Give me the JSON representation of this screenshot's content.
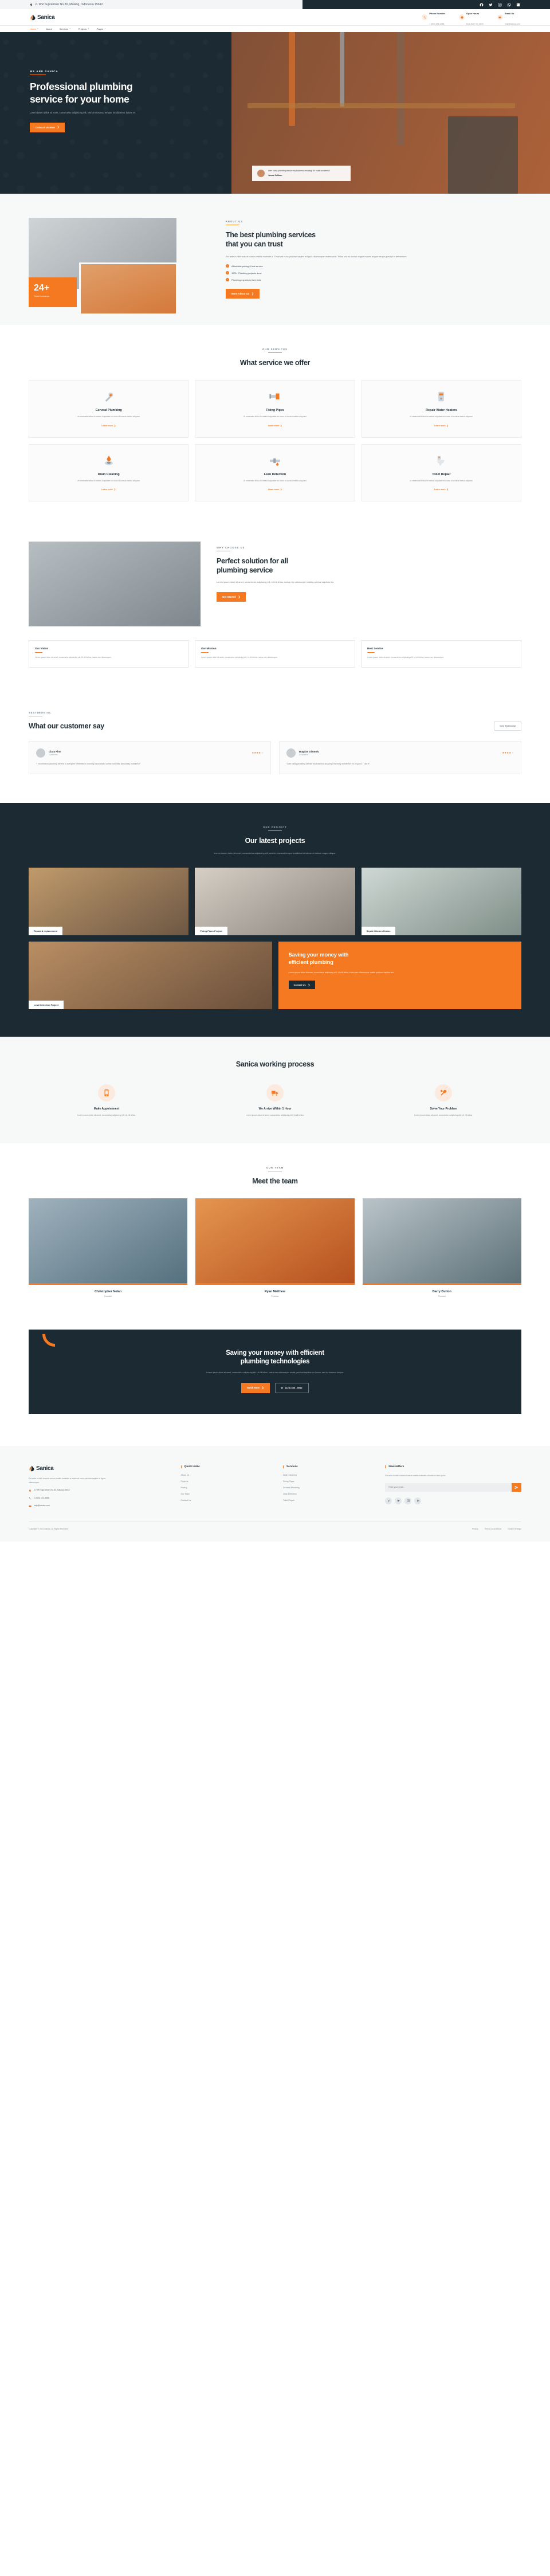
{
  "topbar": {
    "address": "Jl. WR Supratman No.80, Malang, Indonesia 15612",
    "socials": [
      "facebook-icon",
      "twitter-icon",
      "instagram-icon",
      "whatsapp-icon",
      "linkedin-icon"
    ]
  },
  "header": {
    "brand": "Sanica",
    "contacts": [
      {
        "title": "Phone Number",
        "sub": "1 (800) 898-1288"
      },
      {
        "title": "Open Hours",
        "sub": "Mon-Sat 7:00-19:00"
      },
      {
        "title": "Email Us",
        "sub": "help@sanica.com"
      }
    ]
  },
  "nav": {
    "items": [
      {
        "label": "Home",
        "caret": true,
        "active": true
      },
      {
        "label": "About",
        "caret": false,
        "active": false
      },
      {
        "label": "Services",
        "caret": true,
        "active": false
      },
      {
        "label": "Projects",
        "caret": true,
        "active": false
      },
      {
        "label": "Pages",
        "caret": true,
        "active": false
      }
    ]
  },
  "hero": {
    "eyebrow": "WE ARE SANICA",
    "title_line1": "Professional plumbing",
    "title_line2": "service for your home",
    "paragraph": "Lorem ipsum dolor sit amet, consectetur adipiscing elit, sed do eiusmod tempor incididunt ut labore et.",
    "cta": "Contact Us Now",
    "quote": "After using plumbing service my business amazing! It's really wonderful!",
    "quote_author": "James Sullivan"
  },
  "about": {
    "eyebrow": "ABOUT US",
    "title_line1": "The best plumbing services",
    "title_line2": "that you can trust",
    "paragraph": "Est ante in nibh mauris cursus mattis molestie a. Tincidunt nunc pulvinar sapien et ligula ullamcorper malesuada. Tellus orci ac auctor augue mauris augue neque gravida in fermentum.",
    "badge_number": "24+",
    "badge_label": "Years Experience",
    "checklist": [
      "Affordable pricing & fast service",
      "1000+ Plumbing projects done",
      "Plumbing experts in their field"
    ],
    "cta": "More About Us"
  },
  "services": {
    "eyebrow": "OUR SERVICES",
    "title": "What service we offer",
    "more_label": "Learn more",
    "items": [
      {
        "icon": "wrench-icon",
        "title": "General Plumbing",
        "text": "Ut venenatis tellus in metus vulputate eu nunc id cursus metus aliquam."
      },
      {
        "icon": "pipe-icon",
        "title": "Fixing Pipes",
        "text": "Ut venenatis tellus in metus vulputate eu nunc id cursus metus aliquam."
      },
      {
        "icon": "water-heater-icon",
        "title": "Repair Water Heaters",
        "text": "Ut venenatis tellus in metus vulputate eu nunc id cursus metus aliquam."
      },
      {
        "icon": "drain-icon",
        "title": "Drain Cleaning",
        "text": "Ut venenatis tellus in metus vulputate eu nunc id cursus metus aliquam."
      },
      {
        "icon": "leak-detect-icon",
        "title": "Leak Detection",
        "text": "Ut venenatis tellus in metus vulputate eu nunc id cursus metus aliquam."
      },
      {
        "icon": "toilet-icon",
        "title": "Toilet Repair",
        "text": "Ut venenatis tellus in metus vulputate eu nunc id cursus metus aliquam."
      }
    ]
  },
  "why": {
    "eyebrow": "WHY CHOOSE US",
    "title_line1": "Perfect solution for all",
    "title_line2": "plumbing service",
    "paragraph": "Lorem ipsum dolor sit amet, consectetur adipiscing elit. Ut elit tellus, luctus nec ullamcorper mattis pulvinar dapibus leo.",
    "cta": "Get Started",
    "cards": [
      {
        "title": "Our Vision",
        "text": "Lorem ipsum dolor sit amet, consectetur adipiscing elit. Ut elit tellus, luctus nec ullamcorper."
      },
      {
        "title": "Our Mission",
        "text": "Lorem ipsum dolor sit amet, consectetur adipiscing elit. Ut elit tellus, luctus nec ullamcorper."
      },
      {
        "title": "Best Service",
        "text": "Lorem ipsum dolor sit amet, consectetur adipiscing elit. Ut elit tellus, luctus nec ullamcorper."
      }
    ]
  },
  "testimonial": {
    "eyebrow": "TESTIMONIAL",
    "title": "What our customer say",
    "button": "View Testimonial",
    "items": [
      {
        "name": "Clara Finn",
        "role": "Customers",
        "stars": 4,
        "quote": "\"I recommend plumbing service to everyone interested in running a successful online business! Absolutely wonderful!\""
      },
      {
        "name": "Bogdan Diamulu",
        "role": "Customers",
        "stars": 4,
        "quote": "\"After using plumbing service my business amazing! It's really wonderful! It's all good. I Like It\""
      }
    ]
  },
  "projects": {
    "eyebrow": "OUR PROJECT",
    "title": "Our latest projects",
    "paragraph": "Lorem ipsum dolor sit amet, consectetur adipiscing elit, sed do eiusmod tempor incididunt ut labore et dolore magna aliqua.",
    "cards": [
      "Repair & replacement",
      "Fixing Pipes Project",
      "Repair Kitchen Drains",
      "Leak Detection Project"
    ],
    "promo_title_line1": "Saving your money with",
    "promo_title_line2": "efficient plumbing",
    "promo_text": "Lorem ipsum dolor sit amet, consectetur adipiscing elit. Ut elit tellus, luctus nec ullamcorper mattis pulvinar dapibus leo.",
    "promo_cta": "Contact Us"
  },
  "process": {
    "title": "Sanica working process",
    "steps": [
      {
        "icon": "phone-ring-icon",
        "title": "Make Appointment",
        "text": "Lorem ipsum dolor sit amet, consectetur adipiscing elit. Ut elit tellus."
      },
      {
        "icon": "truck-icon",
        "title": "We Arrive Within 1 Hour",
        "text": "Lorem ipsum dolor sit amet, consectetur adipiscing elit. Ut elit tellus."
      },
      {
        "icon": "tools-icon",
        "title": "Solve Your Problem",
        "text": "Lorem ipsum dolor sit amet, consectetur adipiscing elit. Ut elit tellus."
      }
    ]
  },
  "team": {
    "eyebrow": "OUR TEAM",
    "title": "Meet the team",
    "members": [
      {
        "name": "Christopher Nolan",
        "role": "Founder"
      },
      {
        "name": "Ryan Matthew",
        "role": "Plumber"
      },
      {
        "name": "Barry Button",
        "role": "Plumber"
      }
    ]
  },
  "cta": {
    "title_line1": "Saving your money with efficient",
    "title_line2": "plumbing technologies",
    "text": "Lorem ipsum dolor sit amet, consectetur adipiscing elit. Ut elit tellus, luctus nec ullamcorper mattis, pulvinar dapibus leo ipsum, sed do eiusmod tempor.",
    "primary": "Book Now",
    "secondary": "(123) 456 - 8912"
  },
  "footer": {
    "brand": "Sanica",
    "about": "Est ante in nibh mauris cursus mattis molestie a tincidunt nunc pulvinar sapien et ligula ullamcorper.",
    "address": "Jl. WR Supratman No.80, Malang 15612",
    "phone": "1 (800) 123-8888",
    "email": "help@sanica.com",
    "quick_links_title": "Quick Links",
    "quick_links": [
      "About Us",
      "Projects",
      "Pricing",
      "Our Team",
      "Contact Us"
    ],
    "services_title": "Services",
    "services": [
      "Drain Cleaning",
      "Fixing Pipes",
      "General Plumbing",
      "Leak Detection",
      "Toilet Repair"
    ],
    "newsletter_title": "Newsletters",
    "newsletter_text": "Est ante in nibh mauris cursus mattis molestie a tincidunt nunc pulvi.",
    "newsletter_placeholder": "Enter your email...",
    "socials": [
      "facebook-icon",
      "twitter-icon",
      "instagram-icon",
      "linkedin-icon"
    ],
    "copyright": "Copyright © 2022 Sanica. All Rights Reserved",
    "bottom_links": [
      "Privacy",
      "Terms & Conditions",
      "Cookie Settings"
    ]
  },
  "colors": {
    "accent": "#f47920",
    "dark": "#1c2b33",
    "light": "#f7f8f8"
  }
}
